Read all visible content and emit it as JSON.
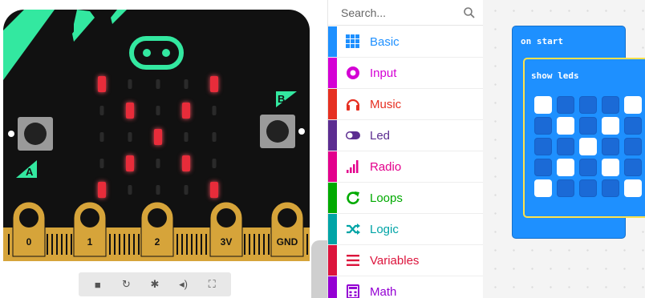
{
  "colors": {
    "board_body": "#111111",
    "board_accent": "#33e8a0",
    "led_on": "#e82c3a",
    "led_off": "#2a2a2a",
    "pin_gold": "#d6a43a",
    "workspace_bg": "#f4f4f4",
    "block_blue": "#1e90ff",
    "block_outline_yellow": "#ffe14a"
  },
  "simulator": {
    "pins": [
      "0",
      "1",
      "2",
      "3V",
      "GND"
    ],
    "button_a_label": "A",
    "button_b_label": "B",
    "led_matrix": [
      [
        1,
        0,
        0,
        0,
        1
      ],
      [
        0,
        1,
        0,
        1,
        0
      ],
      [
        0,
        0,
        1,
        0,
        0
      ],
      [
        0,
        1,
        0,
        1,
        0
      ],
      [
        1,
        0,
        0,
        0,
        1
      ]
    ],
    "toolbar": [
      {
        "name": "stop-icon",
        "glyph": "■"
      },
      {
        "name": "restart-icon",
        "glyph": "↻"
      },
      {
        "name": "debug-icon",
        "glyph": "✱"
      },
      {
        "name": "sound-icon",
        "glyph": "◂)"
      },
      {
        "name": "fullscreen-icon",
        "glyph": "⛶"
      }
    ]
  },
  "toolbox": {
    "search_placeholder": "Search...",
    "categories": [
      {
        "label": "Basic",
        "color": "#1e90ff",
        "icon": "grid-icon"
      },
      {
        "label": "Input",
        "color": "#d400d4",
        "icon": "target-icon"
      },
      {
        "label": "Music",
        "color": "#e63022",
        "icon": "headphones-icon"
      },
      {
        "label": "Led",
        "color": "#5c2d91",
        "icon": "toggle-icon"
      },
      {
        "label": "Radio",
        "color": "#e3008c",
        "icon": "signal-bars-icon"
      },
      {
        "label": "Loops",
        "color": "#00aa00",
        "icon": "loop-arrow-icon"
      },
      {
        "label": "Logic",
        "color": "#00a4a6",
        "icon": "shuffle-icon"
      },
      {
        "label": "Variables",
        "color": "#dc143c",
        "icon": "list-icon"
      },
      {
        "label": "Math",
        "color": "#9400d3",
        "icon": "calculator-icon"
      }
    ]
  },
  "workspace": {
    "on_start_label": "on start",
    "show_leds_label": "show leds",
    "led_pattern": [
      [
        1,
        0,
        0,
        0,
        1
      ],
      [
        0,
        1,
        0,
        1,
        0
      ],
      [
        0,
        0,
        1,
        0,
        0
      ],
      [
        0,
        1,
        0,
        1,
        0
      ],
      [
        1,
        0,
        0,
        0,
        1
      ]
    ]
  }
}
